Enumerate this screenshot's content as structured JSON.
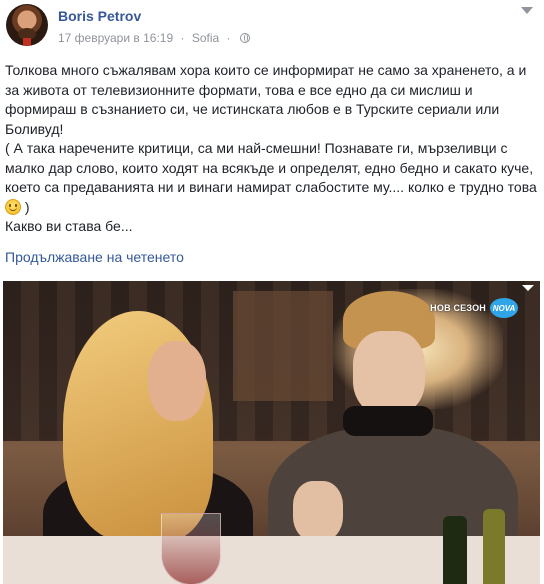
{
  "post": {
    "author": "Boris Petrov",
    "date": "17 февруари в 16:19",
    "separator": "·",
    "location": "Sofia",
    "audience_icon": "globe-icon",
    "paragraphs": [
      "Толкова много съжалявам хора които се информират не само за храненето, а и за живота от телевизионните формати, това е все едно да си мислиш и формираш в съзнанието си, че истинската любов е в Турските сериали или Боливуд!",
      "( А така наречените критици, са ми най-смешни! Познавате ги, мързеливци с малко дар слово, които ходят на всякъде и определят, едно бедно и сакато куче, което са предаванията ни и винаги намират слабостите му.... колко е трудно това",
      ")",
      "Какво ви става бе..."
    ],
    "emoji": "smile-icon",
    "read_more": "Продължаване на четенето"
  },
  "photo": {
    "channel_text": "НОВ СЕЗОН",
    "channel_logo": "NOVA",
    "logo_color": "#2fa4e7"
  },
  "colors": {
    "link": "#365899",
    "meta": "#90949c",
    "text": "#1d2129"
  }
}
